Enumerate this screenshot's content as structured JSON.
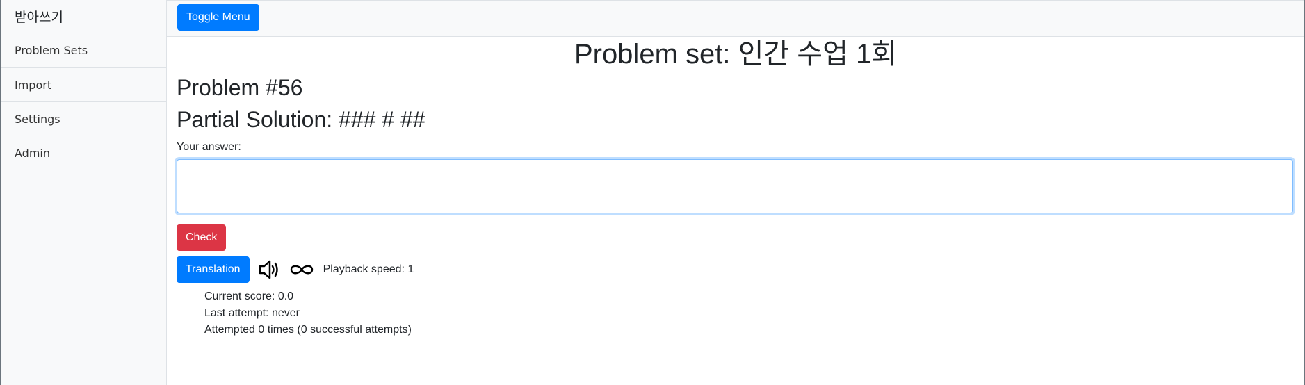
{
  "sidebar": {
    "brand": "받아쓰기",
    "items": [
      {
        "label": "Problem Sets"
      },
      {
        "label": "Import"
      },
      {
        "label": "Settings"
      },
      {
        "label": "Admin"
      }
    ]
  },
  "topbar": {
    "toggle_label": "Toggle Menu"
  },
  "main": {
    "set_title": "Problem set: 인간 수업 1회",
    "problem_title": "Problem #56",
    "partial_solution": "Partial Solution: ### # ##",
    "answer_label": "Your answer:",
    "answer_value": "",
    "check_label": "Check",
    "translation_label": "Translation",
    "speaker_icon": "speaker-icon",
    "loop_icon": "infinity-icon",
    "playback_speed": "Playback speed: 1",
    "stats": {
      "current_score": "Current score: 0.0",
      "last_attempt": "Last attempt: never",
      "attempts": "Attempted 0 times (0 successful attempts)"
    }
  },
  "colors": {
    "primary": "#007bff",
    "danger": "#dc3545",
    "sidebar_bg": "#f8f9fa"
  }
}
